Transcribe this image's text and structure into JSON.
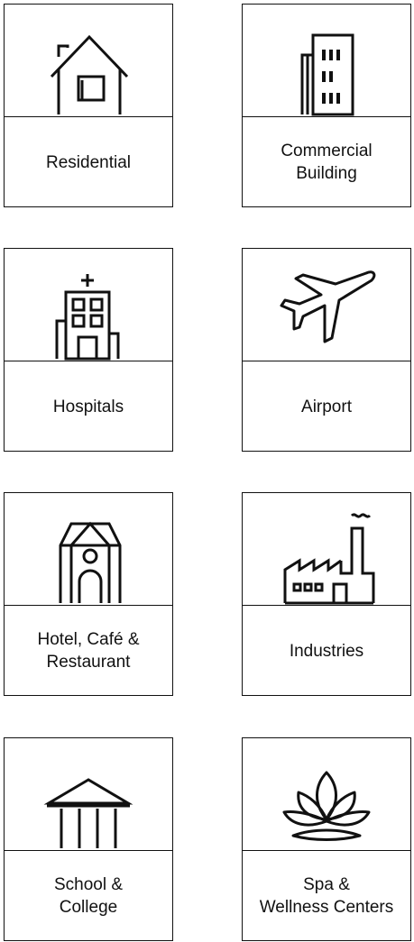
{
  "categories": [
    {
      "id": "residential",
      "label": "Residential",
      "icon": "house-icon"
    },
    {
      "id": "commercial",
      "label": "Commercial\nBuilding",
      "icon": "office-building-icon"
    },
    {
      "id": "hospitals",
      "label": "Hospitals",
      "icon": "hospital-icon"
    },
    {
      "id": "airport",
      "label": "Airport",
      "icon": "airplane-icon"
    },
    {
      "id": "hotel",
      "label": "Hotel, Café &\nRestaurant",
      "icon": "hotel-icon"
    },
    {
      "id": "industries",
      "label": "Industries",
      "icon": "factory-icon"
    },
    {
      "id": "school",
      "label": "School &\nCollege",
      "icon": "school-icon"
    },
    {
      "id": "spa",
      "label": "Spa &\nWellness Centers",
      "icon": "lotus-icon"
    }
  ],
  "colors": {
    "stroke": "#111111",
    "background": "#ffffff"
  }
}
